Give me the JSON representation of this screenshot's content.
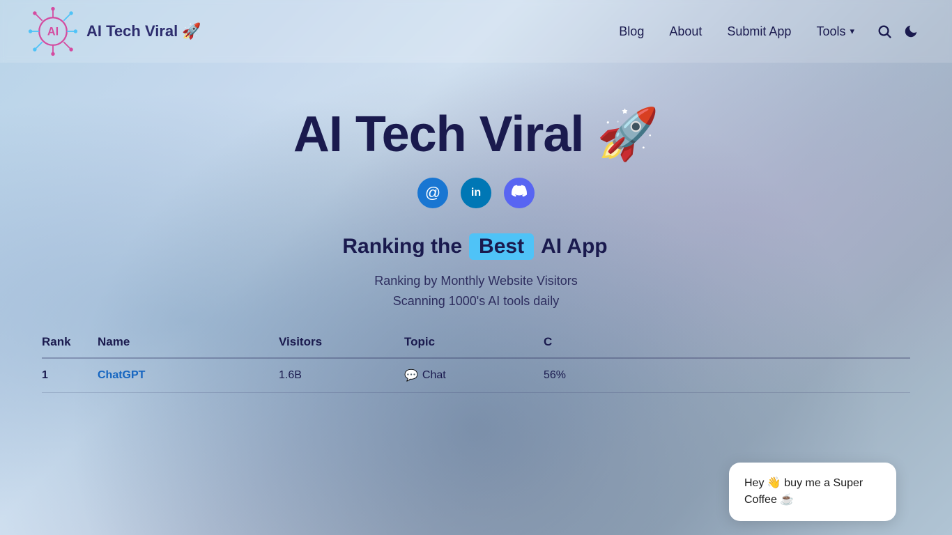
{
  "brand": {
    "name": "AI Tech Viral 🚀",
    "logo_alt": "AI Tech Viral Logo"
  },
  "nav": {
    "links": [
      {
        "id": "blog",
        "label": "Blog"
      },
      {
        "id": "about",
        "label": "About"
      },
      {
        "id": "submit",
        "label": "Submit App"
      },
      {
        "id": "tools",
        "label": "Tools"
      }
    ],
    "tools_has_dropdown": true,
    "search_aria": "Search",
    "dark_mode_aria": "Toggle dark mode"
  },
  "hero": {
    "title": "AI Tech Viral 🚀",
    "subtitle_pre": "Ranking the",
    "subtitle_highlight": "Best",
    "subtitle_post": "AI App",
    "ranking_by": "Ranking by Monthly Website Visitors",
    "scanning": "Scanning 1000's AI tools daily"
  },
  "social": {
    "email_icon": "@",
    "linkedin_icon": "in",
    "discord_icon": "🎮"
  },
  "table": {
    "headers": [
      "Rank",
      "Name",
      "Visitors",
      "Topic",
      "C"
    ],
    "rows": [
      {
        "rank": "1",
        "name": "ChatGPT",
        "visitors": "1.6B",
        "topic": "Chat",
        "other": "56%"
      }
    ]
  },
  "chat_bubble": {
    "text": "Hey 👋 buy me a Super Coffee ☕"
  },
  "colors": {
    "accent_blue": "#4fc3f7",
    "navy": "#1a1a4e",
    "link_blue": "#1565c0"
  }
}
